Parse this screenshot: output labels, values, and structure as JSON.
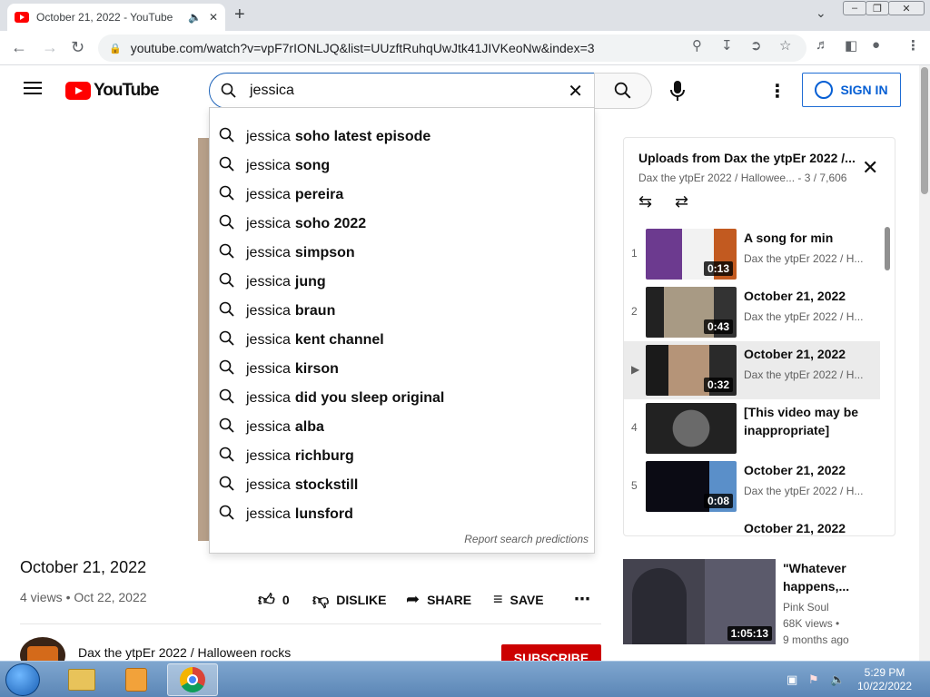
{
  "browser": {
    "tab_title": "October 21, 2022 - YouTube",
    "url": "youtube.com/watch?v=vpF7rIONLJQ&list=UUzftRuhqUwJtk41JIVKeoNw&index=3"
  },
  "header": {
    "logo_text": "YouTube",
    "search_value": "jessica",
    "signin_label": "SIGN IN"
  },
  "suggestions": {
    "prefix": "jessica",
    "items": [
      "soho latest episode",
      "song",
      "pereira",
      "soho 2022",
      "simpson",
      "jung",
      "braun",
      "kent channel",
      "kirson",
      "did you sleep original",
      "alba",
      "richburg",
      "stockstill",
      "lunsford"
    ],
    "report_label": "Report search predictions"
  },
  "video": {
    "title": "October 21, 2022",
    "meta": "4 views • Oct 22, 2022",
    "like_count": "0",
    "dislike_label": "DISLIKE",
    "share_label": "SHARE",
    "save_label": "SAVE",
    "channel_name": "Dax the ytpEr 2022 / Halloween rocks",
    "subscribe_label": "SUBSCRIBE"
  },
  "playlist": {
    "title": "Uploads from Dax the ytpEr 2022 /...",
    "channel": "Dax the ytpEr 2022 / Hallowee...",
    "position": " - 3 / 7,606",
    "items": [
      {
        "index": "1",
        "title": "A song for min",
        "channel": "Dax the ytpEr 2022 / H...",
        "duration": "0:13"
      },
      {
        "index": "2",
        "title": "October 21, 2022",
        "channel": "Dax the ytpEr 2022 / H...",
        "duration": "0:43"
      },
      {
        "index": "▶",
        "title": "October 21, 2022",
        "channel": "Dax the ytpEr 2022 / H...",
        "duration": "0:32"
      },
      {
        "index": "4",
        "title": "[This video may be inappropriate]",
        "channel": "",
        "duration": ""
      },
      {
        "index": "5",
        "title": "October 21, 2022",
        "channel": "Dax the ytpEr 2022 / H...",
        "duration": "0:08"
      },
      {
        "index": "",
        "title": "October 21, 2022",
        "channel": "",
        "duration": ""
      }
    ]
  },
  "recommended": {
    "title": "\"Whatever happens,...",
    "channel": "Pink Soul",
    "views": "68K views •",
    "age": "9 months ago",
    "duration": "1:05:13"
  },
  "taskbar": {
    "time": "5:29 PM",
    "date": "10/22/2022"
  }
}
